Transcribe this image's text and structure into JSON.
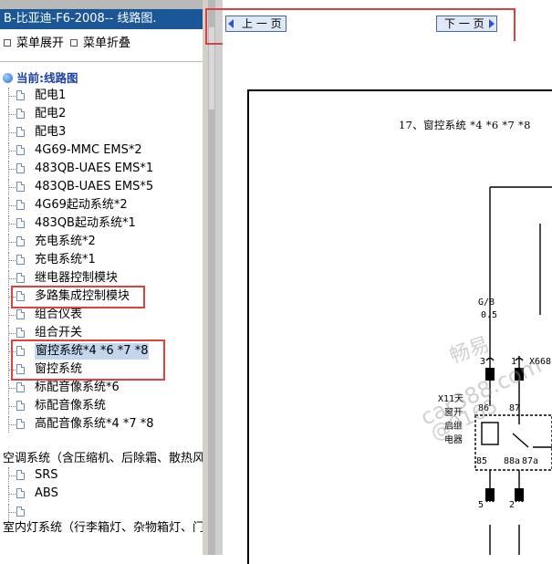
{
  "left_pane": {
    "title": "B-比亚迪-F6-2008-- 线路图.",
    "expand_label": "菜单展开",
    "collapse_label": "菜单折叠",
    "root_label": "当前:线路图",
    "items": [
      {
        "label": "配电1"
      },
      {
        "label": "配电2"
      },
      {
        "label": "配电3"
      },
      {
        "label": "4G69-MMC EMS*2"
      },
      {
        "label": "483QB-UAES EMS*1"
      },
      {
        "label": "483QB-UAES EMS*5"
      },
      {
        "label": "4G69起动系统*2"
      },
      {
        "label": "483QB起动系统*1"
      },
      {
        "label": "充电系统*2"
      },
      {
        "label": "充电系统*1"
      },
      {
        "label": "继电器控制模块"
      },
      {
        "label": "多路集成控制模块"
      },
      {
        "label": "组合仪表"
      },
      {
        "label": "组合开关"
      },
      {
        "label": "窗控系统*4 *6 *7 *8",
        "selected": true
      },
      {
        "label": "窗控系统"
      },
      {
        "label": "标配音像系统*6"
      },
      {
        "label": "标配音像系统"
      },
      {
        "label": "高配音像系统*4 *7 *8"
      }
    ],
    "section_aircon": "空调系统（含压缩机、后除霜、散热风",
    "aircon_children": [
      {
        "label": "SRS"
      },
      {
        "label": "ABS"
      },
      {
        "label": ""
      }
    ],
    "section_interior": "室内灯系统（行李箱灯、杂物箱灯、门"
  },
  "nav": {
    "prev_label": "上 一 页",
    "next_label": "下 一 页"
  },
  "diagram": {
    "title": "17、窗控系统 *4 *6 *7 *8",
    "wire_label": "G/B",
    "wire_gauge": "0.5",
    "relay_label_1": "X11天",
    "relay_label_2": "窗开",
    "relay_label_3": "启继",
    "relay_label_4": "电器",
    "pin_86": "86",
    "pin_87": "87",
    "pin_85": "85",
    "pin_88a": "88a",
    "pin_87a": "87a",
    "pin_3": "3",
    "pin_1": "1",
    "pin_5": "5",
    "pin_2": "2",
    "connector": "X668",
    "watermark_1": "畅易",
    "watermark_2": "car388.com",
    "watermark_3": "@0165"
  },
  "colors": {
    "title_bg": "#1b5797",
    "selected_bg": "#c3d6ee",
    "highlight_box": "#e0413f",
    "button_bg": "#dfe8f5"
  }
}
